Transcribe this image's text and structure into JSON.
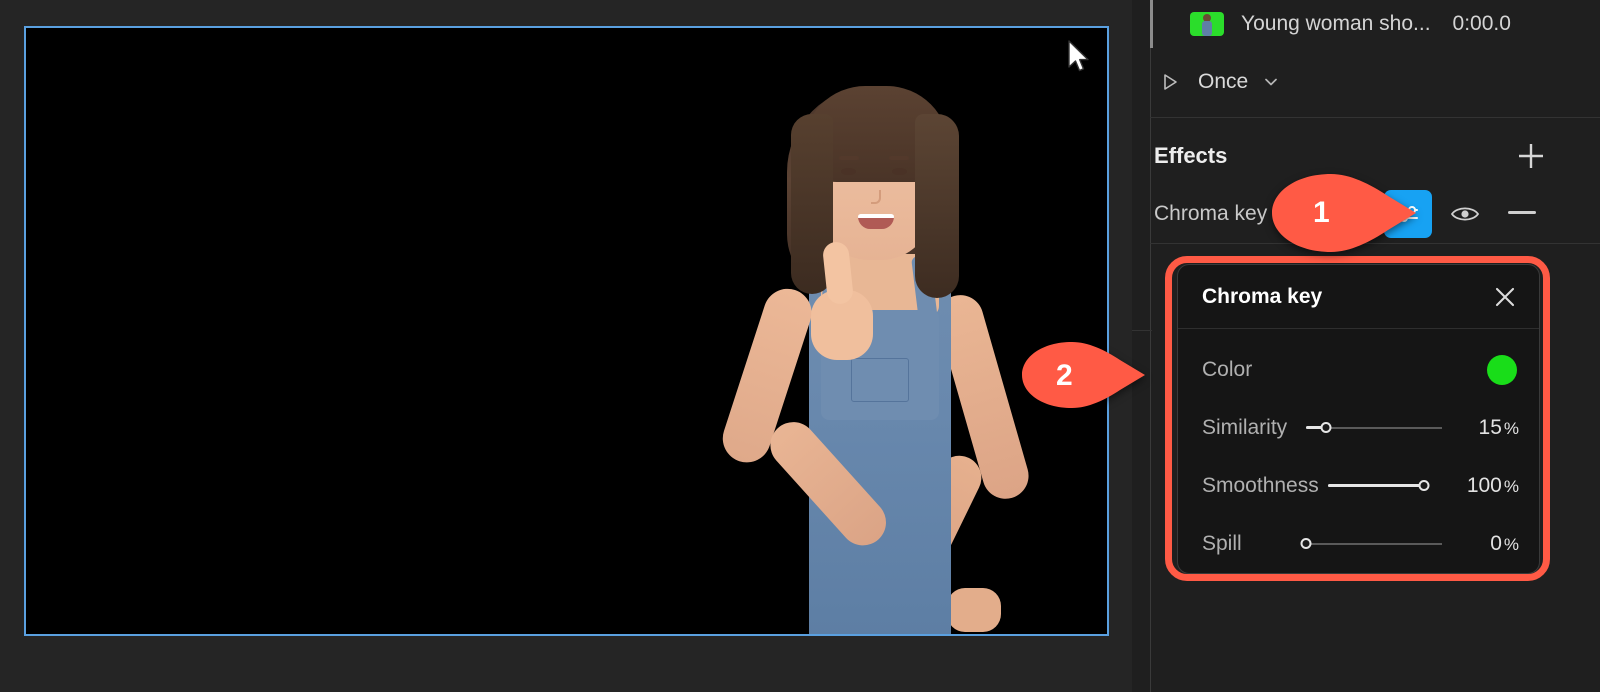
{
  "colors": {
    "accent_blue": "#17a2f3",
    "callout_red": "#ff5a45",
    "selection_blue": "#5aa0e0",
    "chroma_green": "#19dd19",
    "panel_bg": "#151515",
    "sidebar_bg": "#1f1f1f"
  },
  "preview": {
    "name": "video-preview",
    "selected": true,
    "cursor_icon": "arrow-cursor"
  },
  "sidebar": {
    "clip": {
      "thumbnail_icon": "clip-thumbnail",
      "title": "Young woman sho...",
      "timestamp": "0:00.0"
    },
    "loop": {
      "play_icon": "play-triangle-icon",
      "label": "Once",
      "chevron_icon": "chevron-down-icon"
    },
    "effects": {
      "title": "Effects",
      "add_icon": "plus-icon",
      "items": [
        {
          "name": "Chroma key",
          "settings_icon": "sliders-icon",
          "visibility_icon": "eye-icon",
          "remove_icon": "minus-icon"
        }
      ]
    }
  },
  "chroma_panel": {
    "title": "Chroma key",
    "close_icon": "close-x-icon",
    "rows": [
      {
        "label": "Color",
        "type": "swatch",
        "value": "#19dd19"
      },
      {
        "label": "Similarity",
        "type": "slider",
        "value": "15",
        "unit": "%",
        "percent": 15
      },
      {
        "label": "Smoothness",
        "type": "slider",
        "value": "100",
        "unit": "%",
        "percent": 100
      },
      {
        "label": "Spill",
        "type": "slider",
        "value": "0",
        "unit": "%",
        "percent": 0
      }
    ]
  },
  "callouts": [
    {
      "number": "1",
      "points_to": "chroma-key-settings-button"
    },
    {
      "number": "2",
      "points_to": "chroma-key-panel"
    }
  ]
}
